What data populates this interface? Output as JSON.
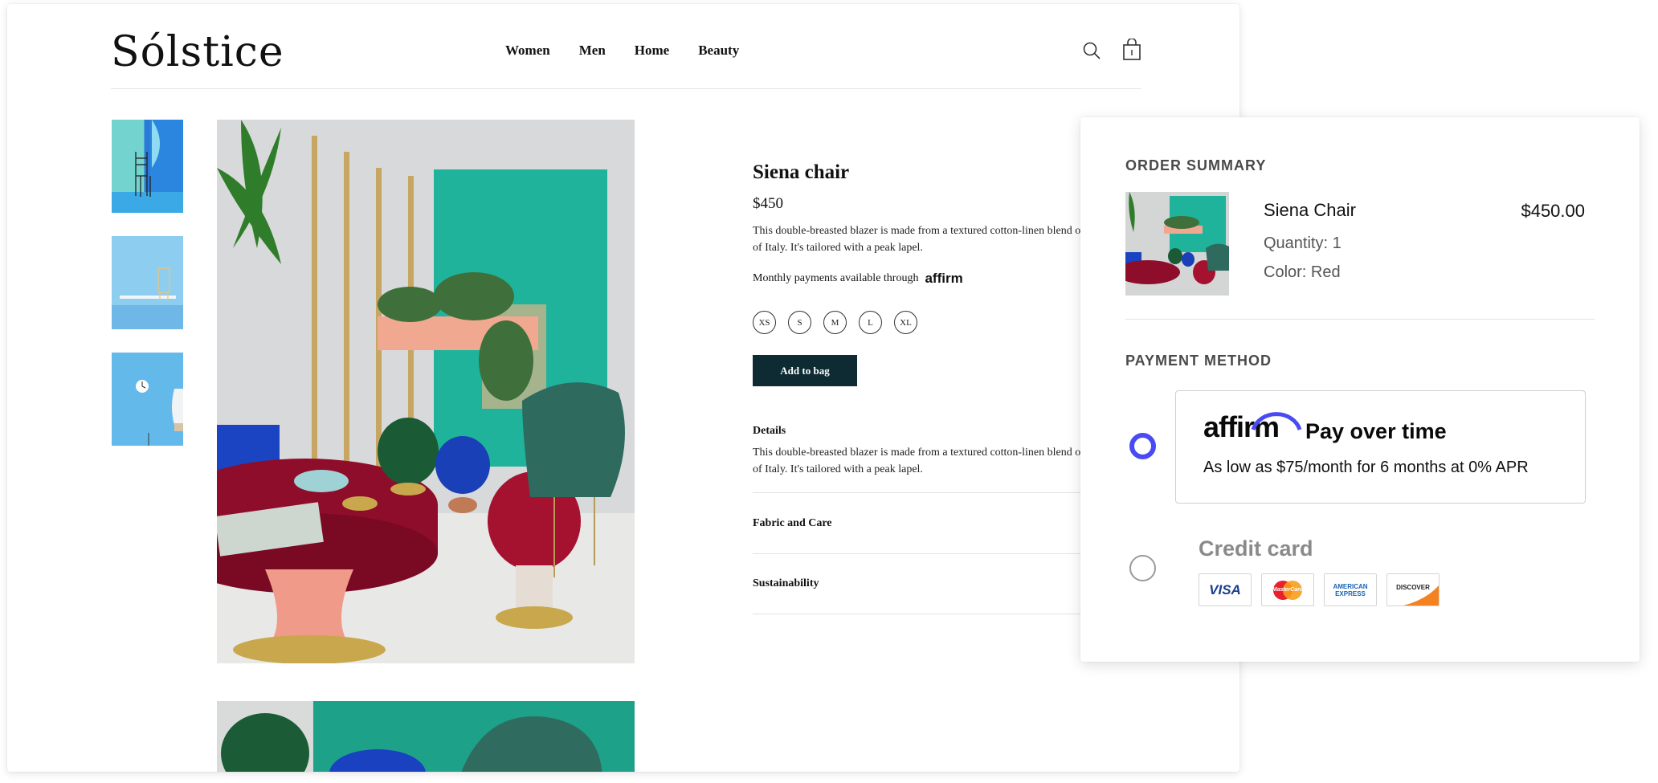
{
  "header": {
    "logo": "Sólstice",
    "nav": [
      "Women",
      "Men",
      "Home",
      "Beauty"
    ]
  },
  "product": {
    "title": "Siena chair",
    "price": "$450",
    "description": "This double-breasted blazer is made from a textured cotton-linen blend out of Italy. It's tailored with a peak lapel.",
    "monthly_text": "Monthly payments available through",
    "affirm_mini": "affirm",
    "sizes": [
      "XS",
      "S",
      "M",
      "L",
      "XL"
    ],
    "add_to_bag": "Add to bag",
    "details_heading": "Details",
    "details_text": "This double-breasted blazer is made from a textured cotton-linen blend out of Italy. It's tailored with a peak lapel.",
    "accordion": [
      "Fabric and Care",
      "Sustainability"
    ]
  },
  "summary": {
    "heading": "ORDER SUMMARY",
    "item_name": "Siena Chair",
    "item_price": "$450.00",
    "quantity": "Quantity: 1",
    "color": "Color: Red",
    "payment_heading": "PAYMENT METHOD",
    "affirm_logo": "affirm",
    "pay_over_time": "Pay over time",
    "pay_over_time_sub": "As low as $75/month for 6 months at 0% APR",
    "credit_card": "Credit card",
    "cards": [
      "VISA",
      "MasterCard",
      "AMERICAN EXPRESS",
      "DISCOVER"
    ]
  },
  "colors": {
    "accent": "#4a4af4",
    "button_dark": "#0e2a33",
    "teal": "#1fb39b"
  }
}
